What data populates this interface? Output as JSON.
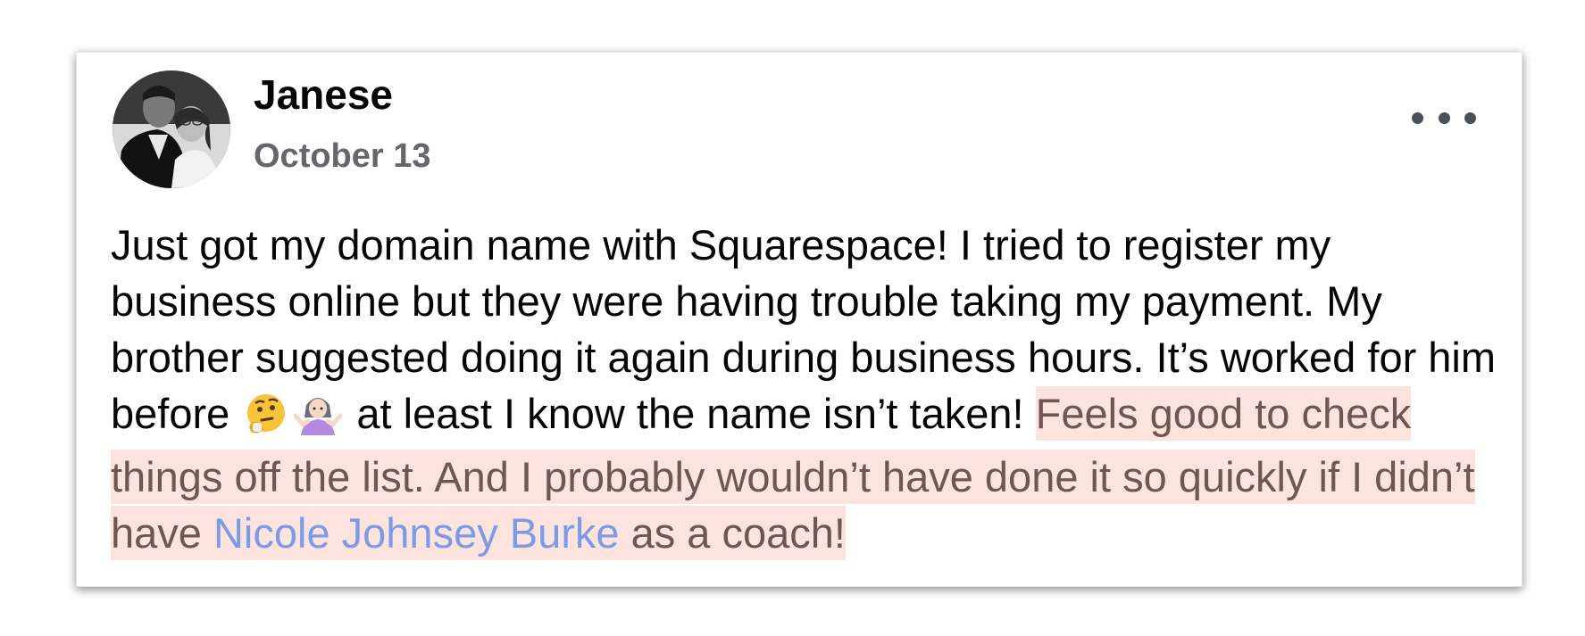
{
  "post": {
    "author": "Janese",
    "date": "October 13",
    "text_part1": "Just got my domain name with Squarespace! I tried to register my business online but they were having trouble taking my payment. My brother suggested doing it again during business hours. It’s worked for him before",
    "emoji_1": "thinking-face-icon",
    "emoji_2": "woman-shrugging-icon",
    "text_part2": " at least I know the name isn’t taken! ",
    "highlight_text": "Feels good to check things off the list. And I probably wouldn’t have done it so quickly if I didn’t have ",
    "mention": "Nicole Johnsey Burke",
    "highlight_end": " as a coach!"
  },
  "colors": {
    "highlight_background": "#fde3dd",
    "highlight_text": "#6f5652",
    "mention": "#7c9be6",
    "date_text": "#65676b"
  }
}
